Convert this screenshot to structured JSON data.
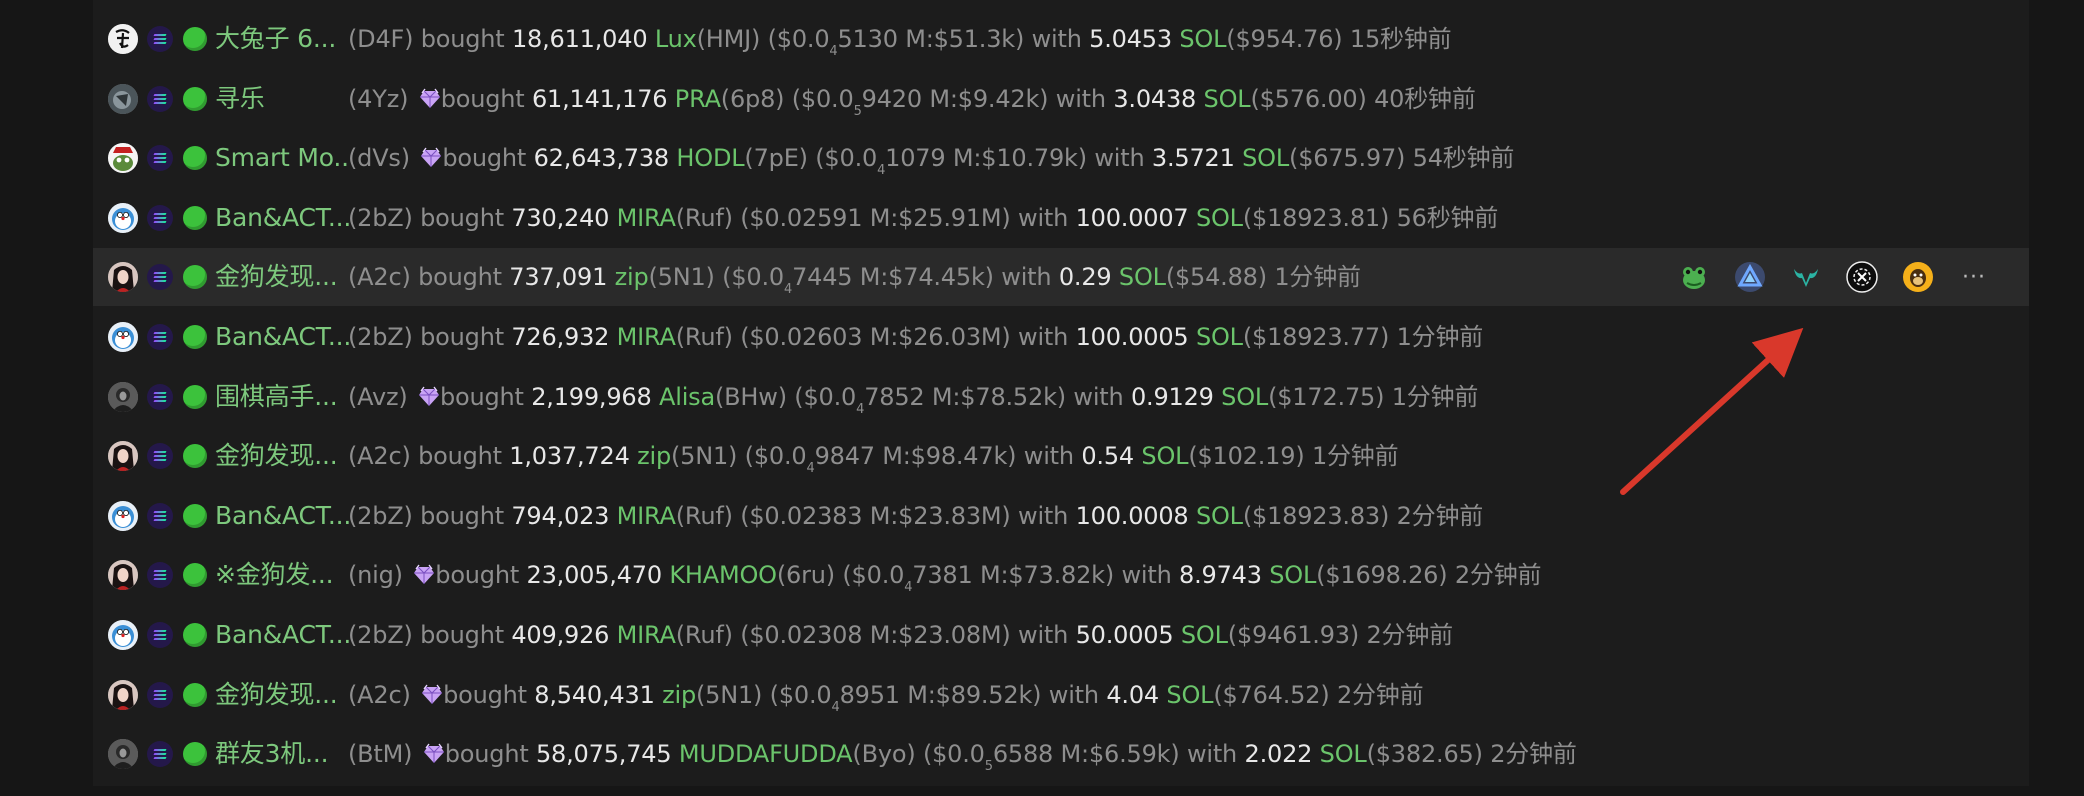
{
  "rows": [
    {
      "avatar": "white",
      "name": "大兔子 6...",
      "wallet": "(D4F)",
      "gem": false,
      "action": "bought",
      "amount": "18,611,040",
      "token": "Lux",
      "token_id": "(HMJ)",
      "price_pre": "($0.0",
      "price_sub": "4",
      "price_post": "5130",
      "mcap": "M:$51.3k)",
      "with_label": "with",
      "sol_amt": "5.0453",
      "sol": "SOL",
      "usd": "($954.76)",
      "time": "15秒钟前"
    },
    {
      "avatar": "gray",
      "name": "寻乐",
      "wallet": "(4Yz)",
      "gem": true,
      "action": "bought",
      "amount": "61,141,176",
      "token": "PRA",
      "token_id": "(6p8)",
      "price_pre": "($0.0",
      "price_sub": "5",
      "price_post": "9420",
      "mcap": "M:$9.42k)",
      "with_label": "with",
      "sol_amt": "3.0438",
      "sol": "SOL",
      "usd": "($576.00)",
      "time": "40秒钟前"
    },
    {
      "avatar": "pepe",
      "name": "Smart Mo...",
      "wallet": "(dVs)",
      "gem": true,
      "action": "bought",
      "amount": "62,643,738",
      "token": "HODL",
      "token_id": "(7pE)",
      "price_pre": "($0.0",
      "price_sub": "4",
      "price_post": "1079",
      "mcap": "M:$10.79k)",
      "with_label": "with",
      "sol_amt": "3.5721",
      "sol": "SOL",
      "usd": "($675.97)",
      "time": "54秒钟前"
    },
    {
      "avatar": "dora",
      "name": "Ban&ACT...",
      "wallet": "(2bZ)",
      "gem": false,
      "action": "bought",
      "amount": "730,240",
      "token": "MIRA",
      "token_id": "(Ruf)",
      "price_pre": "($0.02591",
      "price_sub": "",
      "price_post": "",
      "mcap": "M:$25.91M)",
      "with_label": "with",
      "sol_amt": "100.0007",
      "sol": "SOL",
      "usd": "($18923.81)",
      "time": "56秒钟前"
    },
    {
      "avatar": "girl",
      "name": "金狗发现...",
      "wallet": "(A2c)",
      "gem": false,
      "action": "bought",
      "amount": "737,091",
      "token": "zip",
      "token_id": "(5N1)",
      "price_pre": "($0.0",
      "price_sub": "4",
      "price_post": "7445",
      "mcap": "M:$74.45k)",
      "with_label": "with",
      "sol_amt": "0.29",
      "sol": "SOL",
      "usd": "($54.88)",
      "time": "1分钟前",
      "highlight": true
    },
    {
      "avatar": "dora",
      "name": "Ban&ACT...",
      "wallet": "(2bZ)",
      "gem": false,
      "action": "bought",
      "amount": "726,932",
      "token": "MIRA",
      "token_id": "(Ruf)",
      "price_pre": "($0.02603",
      "price_sub": "",
      "price_post": "",
      "mcap": "M:$26.03M)",
      "with_label": "with",
      "sol_amt": "100.0005",
      "sol": "SOL",
      "usd": "($18923.77)",
      "time": "1分钟前"
    },
    {
      "avatar": "dark",
      "name": "围棋高手...",
      "wallet": "(Avz)",
      "gem": true,
      "action": "bought",
      "amount": "2,199,968",
      "token": "Alisa",
      "token_id": "(BHw)",
      "price_pre": "($0.0",
      "price_sub": "4",
      "price_post": "7852",
      "mcap": "M:$78.52k)",
      "with_label": "with",
      "sol_amt": "0.9129",
      "sol": "SOL",
      "usd": "($172.75)",
      "time": "1分钟前"
    },
    {
      "avatar": "girl",
      "name": "金狗发现...",
      "wallet": "(A2c)",
      "gem": false,
      "action": "bought",
      "amount": "1,037,724",
      "token": "zip",
      "token_id": "(5N1)",
      "price_pre": "($0.0",
      "price_sub": "4",
      "price_post": "9847",
      "mcap": "M:$98.47k)",
      "with_label": "with",
      "sol_amt": "0.54",
      "sol": "SOL",
      "usd": "($102.19)",
      "time": "1分钟前"
    },
    {
      "avatar": "dora",
      "name": "Ban&ACT...",
      "wallet": "(2bZ)",
      "gem": false,
      "action": "bought",
      "amount": "794,023",
      "token": "MIRA",
      "token_id": "(Ruf)",
      "price_pre": "($0.02383",
      "price_sub": "",
      "price_post": "",
      "mcap": "M:$23.83M)",
      "with_label": "with",
      "sol_amt": "100.0008",
      "sol": "SOL",
      "usd": "($18923.83)",
      "time": "2分钟前"
    },
    {
      "avatar": "girl",
      "name": "※金狗发...",
      "wallet": "(nig)",
      "gem": true,
      "action": "bought",
      "amount": "23,005,470",
      "token": "KHAMOO",
      "token_id": "(6ru)",
      "price_pre": "($0.0",
      "price_sub": "4",
      "price_post": "7381",
      "mcap": "M:$73.82k)",
      "with_label": "with",
      "sol_amt": "8.9743",
      "sol": "SOL",
      "usd": "($1698.26)",
      "time": "2分钟前"
    },
    {
      "avatar": "dora",
      "name": "Ban&ACT...",
      "wallet": "(2bZ)",
      "gem": false,
      "action": "bought",
      "amount": "409,926",
      "token": "MIRA",
      "token_id": "(Ruf)",
      "price_pre": "($0.02308",
      "price_sub": "",
      "price_post": "",
      "mcap": "M:$23.08M)",
      "with_label": "with",
      "sol_amt": "50.0005",
      "sol": "SOL",
      "usd": "($9461.93)",
      "time": "2分钟前"
    },
    {
      "avatar": "girl",
      "name": "金狗发现...",
      "wallet": "(A2c)",
      "gem": true,
      "action": "bought",
      "amount": "8,540,431",
      "token": "zip",
      "token_id": "(5N1)",
      "price_pre": "($0.0",
      "price_sub": "4",
      "price_post": "8951",
      "mcap": "M:$89.52k)",
      "with_label": "with",
      "sol_amt": "4.04",
      "sol": "SOL",
      "usd": "($764.52)",
      "time": "2分钟前"
    },
    {
      "avatar": "dark",
      "name": "群友3机...",
      "wallet": "(BtM)",
      "gem": true,
      "action": "bought",
      "amount": "58,075,745",
      "token": "MUDDAFUDDA",
      "token_id": "(Byo)",
      "price_pre": "($0.0",
      "price_sub": "5",
      "price_post": "6588",
      "mcap": "M:$6.59k)",
      "with_label": "with",
      "sol_amt": "2.022",
      "sol": "SOL",
      "usd": "($382.65)",
      "time": "2分钟前"
    }
  ],
  "row_actions": {
    "icons": [
      "frog-icon",
      "triangle-logo-icon",
      "bull-icon",
      "circle-x-icon",
      "monkey-icon"
    ],
    "more_label": "···"
  },
  "colors": {
    "background": "#161616",
    "name": "#7dc87d",
    "token": "#6bc46b",
    "muted": "#8e8e8e",
    "value": "#e8e8e8",
    "annotation_arrow": "#d9382b"
  }
}
